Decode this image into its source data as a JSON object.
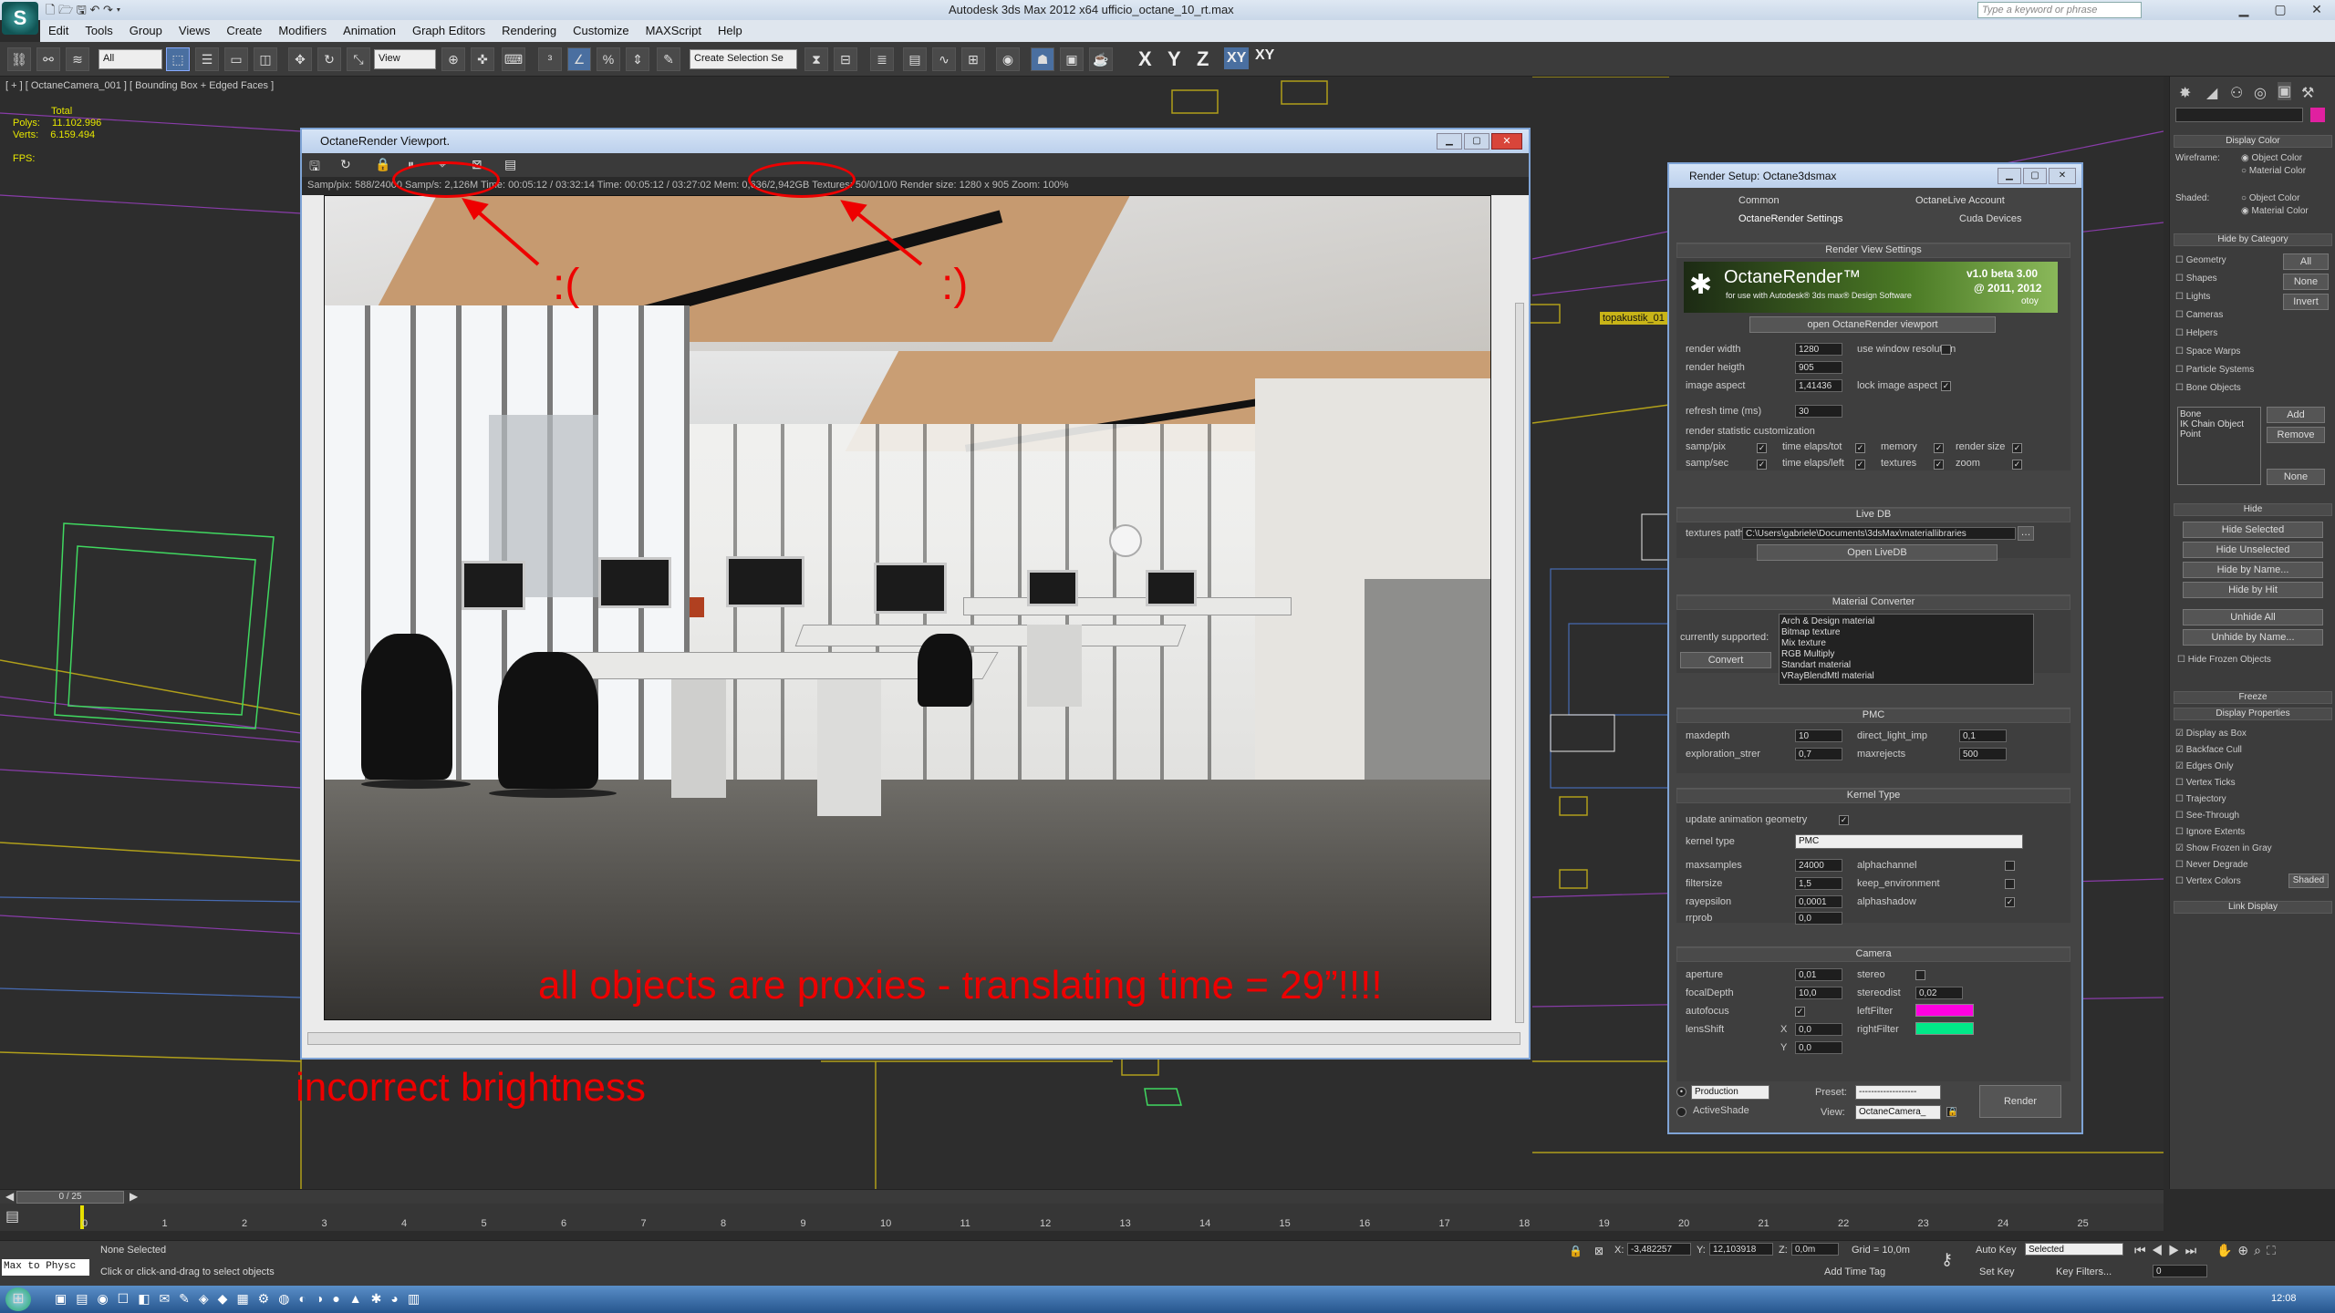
{
  "app": {
    "title": "Autodesk 3ds Max  2012 x64      ufficio_octane_10_rt.max",
    "search_placeholder": "Type a keyword or phrase",
    "logo": "3ds-max-logo"
  },
  "menu": [
    "Edit",
    "Tools",
    "Group",
    "Views",
    "Create",
    "Modifiers",
    "Animation",
    "Graph Editors",
    "Rendering",
    "Customize",
    "MAXScript",
    "Help"
  ],
  "toolbar": {
    "selection_filter": "All",
    "ref_coord": "View",
    "named_sel": "Create Selection Se",
    "axes": [
      "X",
      "Y",
      "Z",
      "XY",
      "XY"
    ]
  },
  "viewport": {
    "label": "[ + ] [ OctaneCamera_001 ] [ Bounding Box + Edged Faces ]",
    "stats_total": "Total",
    "polys_label": "Polys:",
    "polys": "11.102.996",
    "verts_label": "Verts:",
    "verts": "6.159.494",
    "fps_label": "FPS:",
    "object_label": "topakustik_01"
  },
  "octane_viewport": {
    "title": "OctaneRender Viewport.",
    "status": "Samp/pix: 588/24000   Samp/s: 2,126M   Time: 00:05:12 / 03:32:14   Time: 00:05:12 / 03:27:02   Mem: 0,636/2,942GB   Textures: 50/0/10/0   Render size: 1280 x 905   Zoom: 100%"
  },
  "annotations": {
    "sad": ":(",
    "happy": ":)",
    "proxies": "all objects are proxies - translating time = 29”!!!!",
    "brightness": "incorrect brightness"
  },
  "render_setup": {
    "title": "Render Setup: Octane3dsmax",
    "tabs": [
      "Common",
      "OctaneLive Account",
      "OctaneRender Settings",
      "Cuda Devices"
    ],
    "section_render_view": "Render View Settings",
    "banner_name": "OctaneRender™",
    "banner_sub": "for use with Autodesk® 3ds max® Design Software",
    "banner_version": "v1.0 beta 3.00",
    "banner_copy": "@ 2011, 2012",
    "banner_brand": "otoy",
    "open_viewport": "open OctaneRender viewport",
    "render_width_label": "render width",
    "render_width": "1280",
    "render_height_label": "render heigth",
    "render_height": "905",
    "image_aspect_label": "image aspect",
    "image_aspect": "1,41436",
    "use_window_res": "use window resolution",
    "lock_aspect": "lock image aspect",
    "refresh_label": "refresh time (ms)",
    "refresh": "30",
    "stat_custom": "render statistic customization",
    "stat_items": [
      "samp/pix",
      "time elaps/tot",
      "memory",
      "render size",
      "samp/sec",
      "time elaps/left",
      "textures",
      "zoom"
    ],
    "section_livedb": "Live DB",
    "textures_path_label": "textures path",
    "textures_path": "C:\\Users\\gabriele\\Documents\\3dsMax\\materiallibraries",
    "open_livedb": "Open LiveDB",
    "section_matconv": "Material Converter",
    "currently_supported": "currently supported:",
    "mat_list": [
      "Arch & Design material",
      "Bitmap texture",
      "Mix texture",
      "RGB Multiply",
      "Standart material",
      "VRayBlendMtl material"
    ],
    "convert": "Convert",
    "section_pmc": "PMC",
    "maxdepth_label": "maxdepth",
    "maxdepth": "10",
    "direct_light_label": "direct_light_imp",
    "direct_light": "0,1",
    "exploration_label": "exploration_strer",
    "exploration": "0,7",
    "maxrejects_label": "maxrejects",
    "maxrejects": "500",
    "section_kernel": "Kernel Type",
    "update_anim": "update animation geometry",
    "kernel_type_label": "kernel type",
    "kernel_type": "PMC",
    "maxsamples_label": "maxsamples",
    "maxsamples": "24000",
    "alphachannel": "alphachannel",
    "filtersize_label": "filtersize",
    "filtersize": "1,5",
    "keep_env": "keep_environment",
    "rayepsilon_label": "rayepsilon",
    "rayepsilon": "0,0001",
    "alphashadow": "alphashadow",
    "rrprob_label": "rrprob",
    "rrprob": "0,0",
    "section_camera": "Camera",
    "aperture_label": "aperture",
    "aperture": "0,01",
    "stereo": "stereo",
    "focal_label": "focalDepth",
    "focal": "10,0",
    "stereodist_label": "stereodist",
    "stereodist": "0,02",
    "autofocus": "autofocus",
    "leftfilter": "leftFilter",
    "leftfilter_color": "#ff00e0",
    "lensshift": "lensShift",
    "x_label": "X",
    "lensx": "0,0",
    "rightfilter": "rightFilter",
    "rightfilter_color": "#00e888",
    "y_label": "Y",
    "lensy": "0,0",
    "production": "Production",
    "activeshade": "ActiveShade",
    "preset_label": "Preset:",
    "preset": "-------------------",
    "view_label": "View:",
    "view": "OctaneCamera_",
    "render_btn": "Render"
  },
  "command_panel": {
    "display_color": "Display Color",
    "wireframe": "Wireframe:",
    "object_color": "Object Color",
    "material_color": "Material Color",
    "shaded": "Shaded:",
    "hide_by_category": "Hide by Category",
    "categories": [
      "Geometry",
      "Shapes",
      "Lights",
      "Cameras",
      "Helpers",
      "Space Warps",
      "Particle Systems",
      "Bone Objects"
    ],
    "all": "All",
    "none": "None",
    "invert": "Invert",
    "bone_list": [
      "Bone",
      "IK Chain Object",
      "Point"
    ],
    "add": "Add",
    "remove": "Remove",
    "none2": "None",
    "hide": "Hide",
    "hide_buttons": [
      "Hide Selected",
      "Hide Unselected",
      "Hide by Name...",
      "Hide by Hit",
      "Unhide All",
      "Unhide by Name...",
      "Hide Frozen Objects"
    ],
    "freeze": "Freeze",
    "display_properties": "Display Properties",
    "props": [
      "Display as Box",
      "Backface Cull",
      "Edges Only",
      "Vertex Ticks",
      "Trajectory",
      "See-Through",
      "Ignore Extents",
      "Show Frozen in Gray",
      "Never Degrade",
      "Vertex Colors"
    ],
    "shaded_btn": "Shaded",
    "link_display": "Link Display"
  },
  "timeline": {
    "frame": "0 / 25",
    "ticks": [
      "0",
      "1",
      "2",
      "3",
      "4",
      "5",
      "6",
      "7",
      "8",
      "9",
      "10",
      "11",
      "12",
      "13",
      "14",
      "15",
      "16",
      "17",
      "18",
      "19",
      "20",
      "21",
      "22",
      "23",
      "24",
      "25"
    ]
  },
  "statusbar": {
    "maxscript": "Max to Physc",
    "selection": "None Selected",
    "prompt": "Click or click-and-drag to select objects",
    "x_label": "X:",
    "x": "-3,482257",
    "y_label": "Y:",
    "y": "12,103918",
    "z_label": "Z:",
    "z": "0,0m",
    "grid": "Grid = 10,0m",
    "auto_key": "Auto Key",
    "set_key": "Set Key",
    "selected": "Selected",
    "key_filters": "Key Filters...",
    "add_time_tag": "Add Time Tag",
    "frame": "0"
  },
  "taskbar": {
    "time": "12:08"
  }
}
